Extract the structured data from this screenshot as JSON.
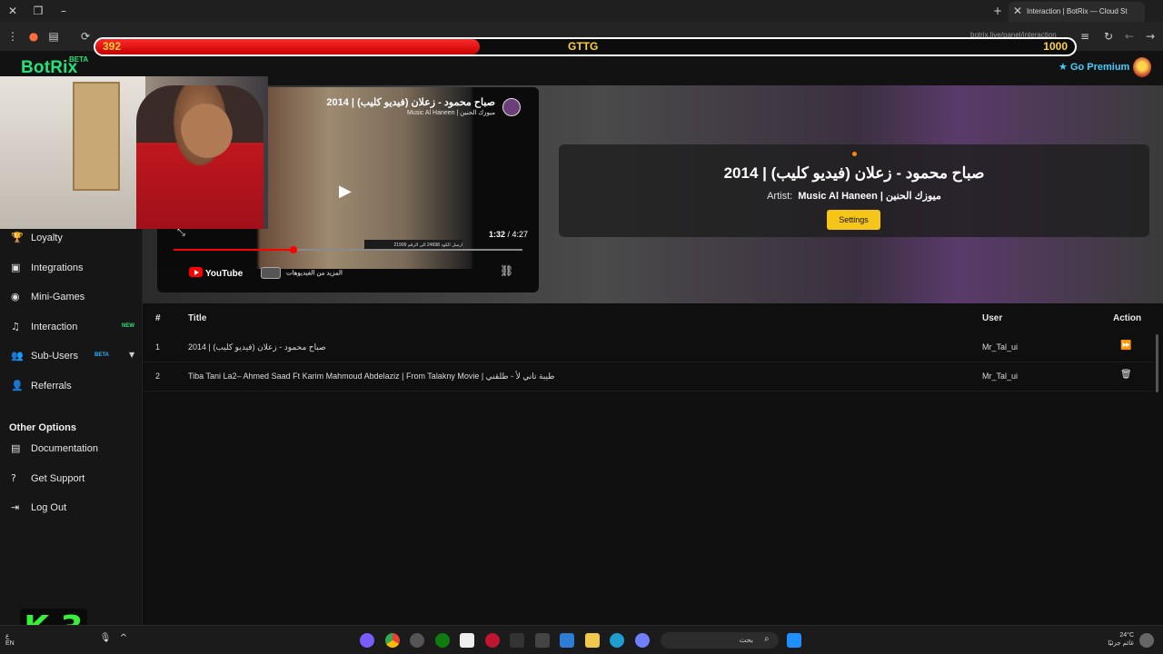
{
  "browser": {
    "active_tab_title": "Interaction | BotRix — Cloud St",
    "url": "botrix.live/panel/interaction"
  },
  "stream_overlay": {
    "hp_left": "392",
    "hp_label": "GTTG",
    "hp_right": "1000",
    "hp_fraction": 0.392,
    "bar_color": "#e00000",
    "text_color": "#ffd23a"
  },
  "app": {
    "logo": "BotRix",
    "logo_badge": "BETA",
    "go_premium": "Go Premium",
    "brand_color": "#22e37a"
  },
  "sidebar": {
    "items": [
      {
        "label": "Loyalty",
        "icon": "trophy-icon"
      },
      {
        "label": "Integrations",
        "icon": "integrations-icon"
      },
      {
        "label": "Mini-Games",
        "icon": "gamepad-icon"
      },
      {
        "label": "Interaction",
        "icon": "music-icon",
        "badge": "NEW"
      },
      {
        "label": "Sub-Users",
        "icon": "users-icon",
        "badge": "BETA"
      },
      {
        "label": "Referrals",
        "icon": "referrals-icon"
      }
    ],
    "other_heading": "Other Options",
    "other_items": [
      {
        "label": "Documentation",
        "icon": "document-icon"
      },
      {
        "label": "Get Support",
        "icon": "help-icon"
      },
      {
        "label": "Log Out",
        "icon": "logout-icon"
      }
    ]
  },
  "player": {
    "video_title": "صباح محمود - زعلان (فيديو كليب) | 2014",
    "channel": "Music Al Haneen | ميوزك الحنين",
    "time_current": "1:32",
    "time_total": "4:27",
    "progress_fraction": 0.344,
    "youtube_label": "YouTube",
    "more_videos": "المزيد من الفيديوهات",
    "overlay_strip": "ارسل الكود 24698 الى الرقم 21999"
  },
  "now_playing": {
    "title": "صباح محمود - زعلان (فيديو كليب) | 2014",
    "artist_label": "Artist:",
    "artist": "Music Al Haneen | ميوزك الحنين",
    "settings_label": "Settings",
    "accent_color": "#f5c518"
  },
  "queue": {
    "headers": {
      "num": "#",
      "title": "Title",
      "user": "User",
      "action": "Action"
    },
    "rows": [
      {
        "num": "1",
        "title": "صباح محمود - زعلان (فيديو كليب) | 2014",
        "user": "Mr_Tal_ui",
        "action_icon": "skip-forward-icon",
        "action_glyph": "⏩"
      },
      {
        "num": "2",
        "title": "Tiba Tani La2– Ahmed Saad Ft Karim Mahmoud Abdelaziz | From Talakny Movie | طيبة تاني لأ - طلقني",
        "user": "Mr_Tal_ui",
        "action_icon": "trash-icon",
        "action_glyph": "🗑"
      }
    ]
  },
  "watermark": "K 3",
  "taskbar": {
    "search_placeholder": "بحث",
    "weather_temp": "24°C",
    "weather_desc": "غائم جزئيًا",
    "locale": "ع\nEN"
  }
}
